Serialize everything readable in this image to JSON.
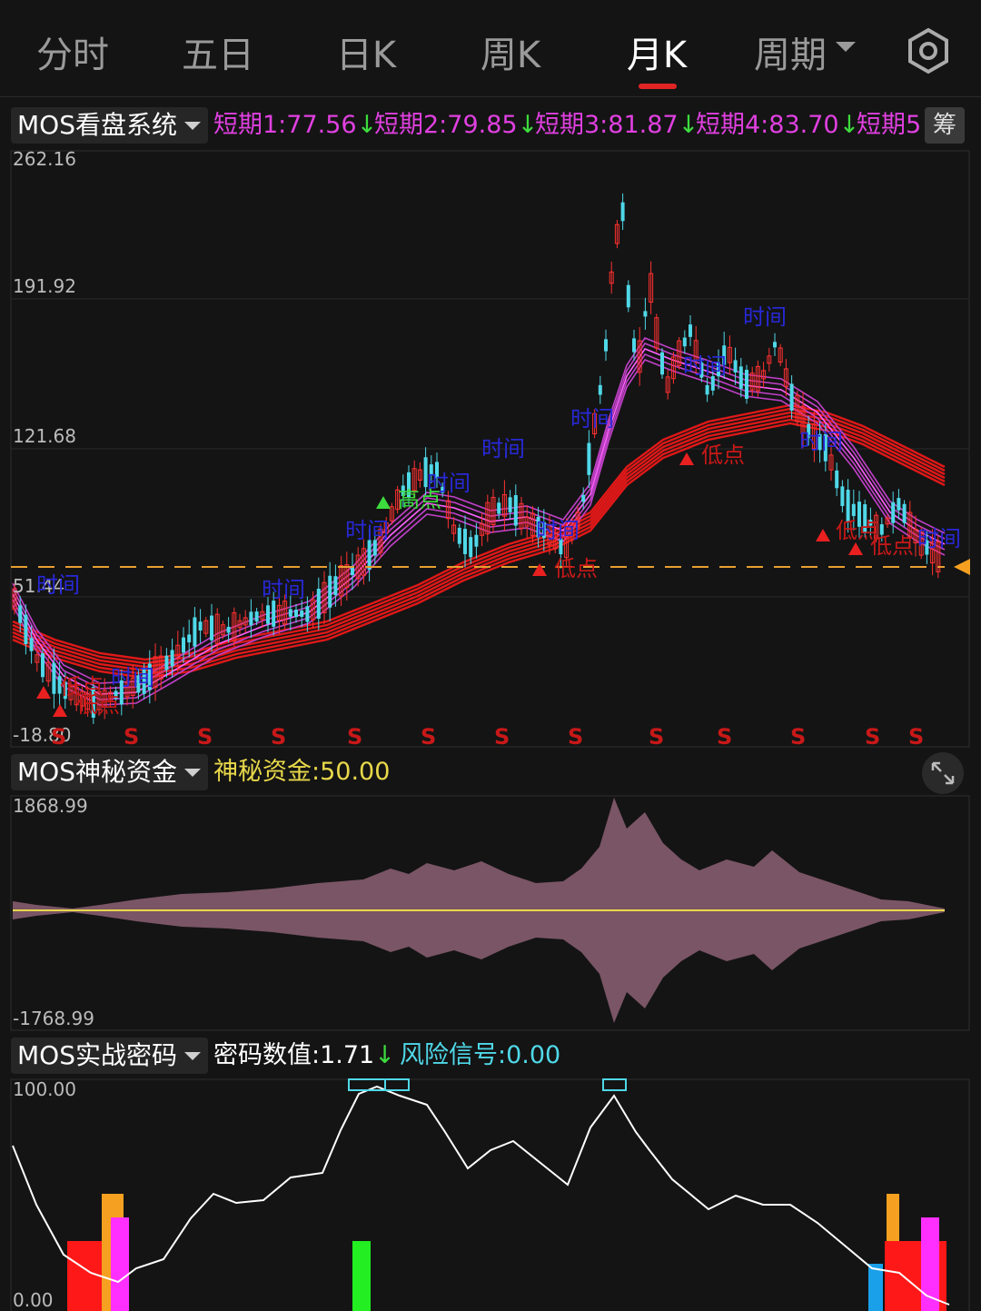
{
  "tabs": [
    {
      "label": "分时"
    },
    {
      "label": "五日"
    },
    {
      "label": "日K"
    },
    {
      "label": "周K"
    },
    {
      "label": "月K"
    },
    {
      "label": "周期"
    }
  ],
  "active_tab": "月K",
  "colors": {
    "accent": "#e02424",
    "magenta": "#e040e0",
    "cyan": "#4fd8e8",
    "yellow": "#e8d84a",
    "green": "#3ddc3d",
    "red": "#ff2020",
    "orange": "#f5a020"
  },
  "main": {
    "indicator_name": "MOS看盘系统",
    "values": [
      {
        "label": "短期1:",
        "value": "77.56",
        "arrow": "↓"
      },
      {
        "label": "短期2:",
        "value": "79.85",
        "arrow": "↓"
      },
      {
        "label": "短期3:",
        "value": "81.87",
        "arrow": "↓"
      },
      {
        "label": "短期4:",
        "value": "83.70",
        "arrow": "↓"
      },
      {
        "label": "短期5",
        "value": "",
        "arrow": ""
      }
    ],
    "chip_label": "筹",
    "y_labels": [
      "262.16",
      "191.92",
      "121.68",
      "51.44",
      "-18.80"
    ],
    "annotations": {
      "time": "时间",
      "low": "低点",
      "high": "高点",
      "sell": "S"
    }
  },
  "fund": {
    "indicator_name": "MOS神秘资金",
    "label": "神秘资金:",
    "value": "50.00",
    "y_labels": [
      "1868.99",
      "-1768.99"
    ]
  },
  "code": {
    "indicator_name": "MOS实战密码",
    "label1": "密码数值:",
    "value1": "1.71",
    "arrow1": "↓",
    "label2": "风险信号:",
    "value2": "0.00",
    "y_labels": [
      "100.00",
      "0.00"
    ]
  }
}
